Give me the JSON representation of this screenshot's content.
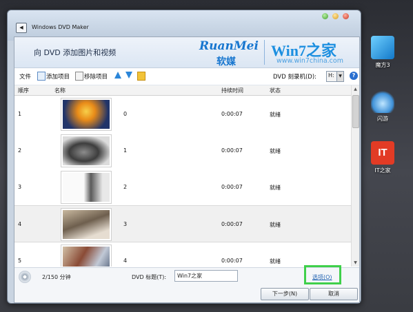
{
  "desktop": {
    "icons": [
      {
        "label": "魔方3",
        "icon": "mofang-cube-icon"
      },
      {
        "label": "闪游",
        "icon": "shanyou-icon"
      },
      {
        "label": "IT之家",
        "icon": "it-home-icon",
        "glyph": "IT"
      }
    ]
  },
  "window": {
    "title": "Windows DVD Maker",
    "back_glyph": "◀"
  },
  "banner": {
    "heading": "向 DVD 添加图片和视频",
    "logo_ruanmei": "RuanMei",
    "logo_ruanmei_cn": "软媒",
    "logo_win7": "Win7之家",
    "logo_url": "www.win7china.com"
  },
  "toolbar": {
    "file_label": "文件",
    "add_label": "添加项目",
    "remove_label": "移除项目",
    "drive_label": "DVD 刻录机(D):",
    "drive_value": "H:",
    "help": "?"
  },
  "table": {
    "headers": [
      "顺序",
      "名称",
      "持续时间",
      "状态"
    ],
    "rows": [
      {
        "order": "1",
        "name": "0",
        "duration": "0:00:07",
        "status": "就绪"
      },
      {
        "order": "2",
        "name": "1",
        "duration": "0:00:07",
        "status": "就绪"
      },
      {
        "order": "3",
        "name": "2",
        "duration": "0:00:07",
        "status": "就绪"
      },
      {
        "order": "4",
        "name": "3",
        "duration": "0:00:07",
        "status": "就绪"
      },
      {
        "order": "5",
        "name": "4",
        "duration": "0:00:07",
        "status": "就绪"
      }
    ],
    "selected_row": 3
  },
  "footer": {
    "size_text": "2/150 分钟",
    "dvd_title_label": "DVD 标题(T):",
    "dvd_title_value": "Win7之家",
    "options_label": "选项(O)",
    "next_button": "下一步(N)",
    "cancel_button": "取消"
  },
  "colors": {
    "highlight": "#3fd04a",
    "link": "#1c5fb0",
    "accent": "#1776cf"
  }
}
